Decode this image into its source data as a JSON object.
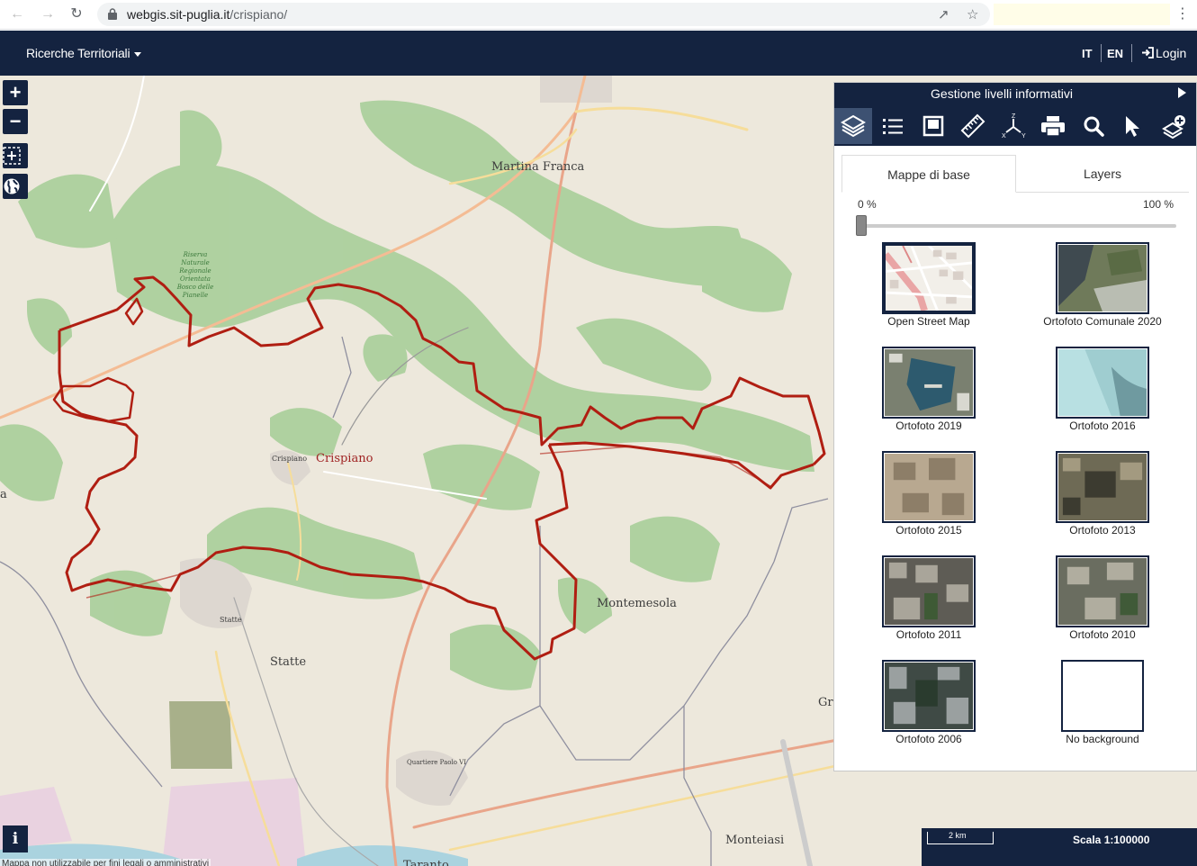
{
  "browser": {
    "url_host": "webgis.sit-puglia.it",
    "url_path": "/crispiano/"
  },
  "header": {
    "title": "Ricerche Territoriali",
    "lang_it": "IT",
    "lang_en": "EN",
    "login": "Login"
  },
  "map": {
    "places": {
      "martina_franca": "Martina Franca",
      "crispiano": "Crispiano",
      "crispiano_small": "Crispiano",
      "montemesola": "Montemesola",
      "statte": "Statte",
      "statte_small": "Statte",
      "monteiasi": "Monteiasi",
      "taranto": "Taranto",
      "quartiere_paolo_vi": "Quartiere Paolo VI",
      "gr": "Gr",
      "a": "a",
      "riserva": "Riserva Naturale Regionale Orientata Bosco delle Pianelle"
    },
    "disclaimer": "Mappa non utilizzabile per fini legali o amministrativi",
    "scale_bar": "2 km",
    "scale_text": "Scala 1:100000",
    "colors": {
      "boundary": "#b01e12",
      "forest": "#acd09d",
      "land": "#ede8dc"
    }
  },
  "panel": {
    "title": "Gestione livelli informativi",
    "tools": [
      "layers-icon",
      "list-icon",
      "frame-icon",
      "ruler-icon",
      "axes-icon",
      "print-icon",
      "search-icon",
      "pointer-icon",
      "add-layer-icon"
    ],
    "tabs": {
      "base": "Mappe di base",
      "layers": "Layers"
    },
    "opacity_min": "0 %",
    "opacity_max": "100 %",
    "opacity_value": 0,
    "basemaps": [
      {
        "label": "Open Street Map",
        "selected": true
      },
      {
        "label": "Ortofoto Comunale 2020"
      },
      {
        "label": "Ortofoto 2019"
      },
      {
        "label": "Ortofoto 2016"
      },
      {
        "label": "Ortofoto 2015"
      },
      {
        "label": "Ortofoto 2013"
      },
      {
        "label": "Ortofoto 2011"
      },
      {
        "label": "Ortofoto 2010"
      },
      {
        "label": "Ortofoto 2006"
      },
      {
        "label": "No background"
      }
    ]
  }
}
